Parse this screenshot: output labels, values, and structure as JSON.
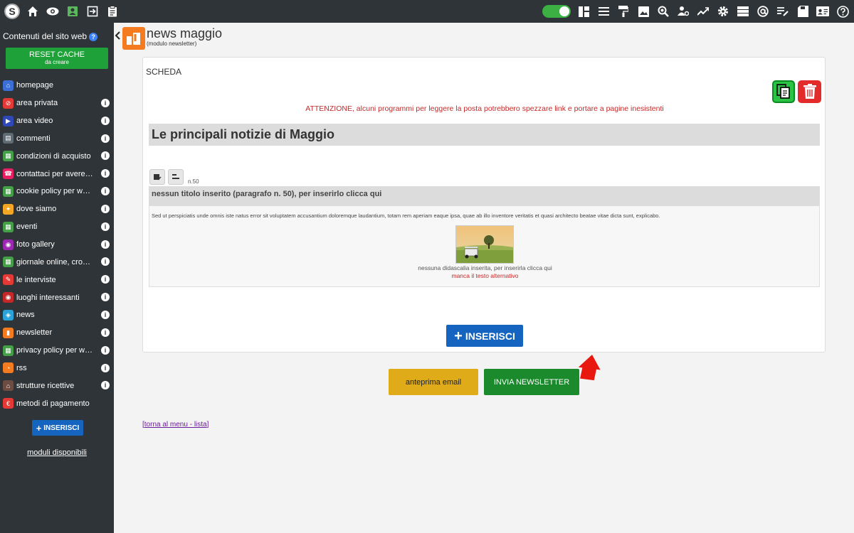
{
  "colors": {
    "topbar_bg": "#2f3438",
    "toggle_green": "#3cb043",
    "reset_green": "#1fa13a",
    "insert_blue": "#1565c0",
    "warning_red": "#c62828",
    "preview_yellow": "#e0ab19",
    "send_green": "#1b8a2c",
    "arrow_red": "#e8170f"
  },
  "topbar": {
    "left_icons": [
      "logo-s-icon",
      "home-icon",
      "eye-icon",
      "contact-card-icon",
      "logout-icon",
      "clipboard-icon"
    ],
    "logo_letter": "S",
    "right_icons": [
      "dashboard-icon",
      "menu-icon",
      "paint-roller-icon",
      "image-icon",
      "search-settings-icon",
      "users-settings-icon",
      "trend-icon",
      "gear-icon",
      "database-icon",
      "at-icon",
      "edit-list-icon",
      "save-icon",
      "id-card-icon",
      "help-icon"
    ]
  },
  "sidebar": {
    "title": "Contenuti del sito web",
    "help": "?",
    "reset_label": "RESET CACHE",
    "reset_sub": "da creare",
    "items": [
      {
        "label": "homepage",
        "icon": "home-icon",
        "color": "#3b6fd6",
        "info": false
      },
      {
        "label": "area privata",
        "icon": "block-icon",
        "color": "#e53935",
        "info": true
      },
      {
        "label": "area video",
        "icon": "video-icon",
        "color": "#2f48b7",
        "info": true
      },
      {
        "label": "commenti",
        "icon": "comment-icon",
        "color": "#5f6b73",
        "info": true
      },
      {
        "label": "condizioni di acquisto",
        "icon": "document-icon",
        "color": "#43a047",
        "info": true
      },
      {
        "label": "contattaci per avere ...",
        "icon": "phone-icon",
        "color": "#e91e63",
        "info": true
      },
      {
        "label": "cookie policy per ww...",
        "icon": "document-icon",
        "color": "#43a047",
        "info": true
      },
      {
        "label": "dove siamo",
        "icon": "map-icon",
        "color": "#f5a623",
        "info": true
      },
      {
        "label": "eventi",
        "icon": "calendar-icon",
        "color": "#43a047",
        "info": true
      },
      {
        "label": "foto gallery",
        "icon": "camera-icon",
        "color": "#9c27b0",
        "info": true
      },
      {
        "label": "giornale online, crona...",
        "icon": "document-icon",
        "color": "#43a047",
        "info": true
      },
      {
        "label": "le interviste",
        "icon": "microphone-icon",
        "color": "#e53935",
        "info": true
      },
      {
        "label": "luoghi interessanti",
        "icon": "place-icon",
        "color": "#c62828",
        "info": true
      },
      {
        "label": "news",
        "icon": "news-icon",
        "color": "#29a3d9",
        "info": true
      },
      {
        "label": "newsletter",
        "icon": "newsletter-icon",
        "color": "#f47b20",
        "info": true
      },
      {
        "label": "privacy policy per ww...",
        "icon": "document-icon",
        "color": "#43a047",
        "info": true
      },
      {
        "label": "rss",
        "icon": "rss-icon",
        "color": "#f47b20",
        "info": true
      },
      {
        "label": "strutture ricettive",
        "icon": "hotel-icon",
        "color": "#6d4c41",
        "info": true
      },
      {
        "label": "metodi di pagamento",
        "icon": "payment-icon",
        "color": "#e53935",
        "info": false
      }
    ],
    "info_glyph": "i",
    "insert_label": "INSERISCI",
    "moduli_label": "moduli disponibili"
  },
  "main": {
    "title": "news maggio",
    "subtitle": "(modulo newsletter)",
    "scheda": "SCHEDA",
    "warning": "ATTENZIONE, alcuni programmi per leggere la posta potrebbero spezzare link e portare a pagine inesistenti",
    "headline": "Le principali notizie di Maggio",
    "paragraph_number": "n.50",
    "paragraph": {
      "title": "nessun titolo inserito (paragrafo n. 50), per inserirlo clicca qui",
      "text": "Sed ut perspiciatis unde omnis iste natus error sit voluptatem accusantium doloremque laudantium, totam rem aperiam eaque ipsa, quae ab illo inventore veritatis et quasi architecto beatae vitae dicta sunt, explicabo.",
      "caption": "nessuna didascalia inserita, per inserirla clicca qui",
      "alt_warning": "manca il testo alternativo"
    },
    "insert_label": "INSERISCI",
    "preview_label": "anteprima email",
    "send_label": "INVIA NEWSLETTER",
    "back_link": "torna al menu - lista"
  }
}
